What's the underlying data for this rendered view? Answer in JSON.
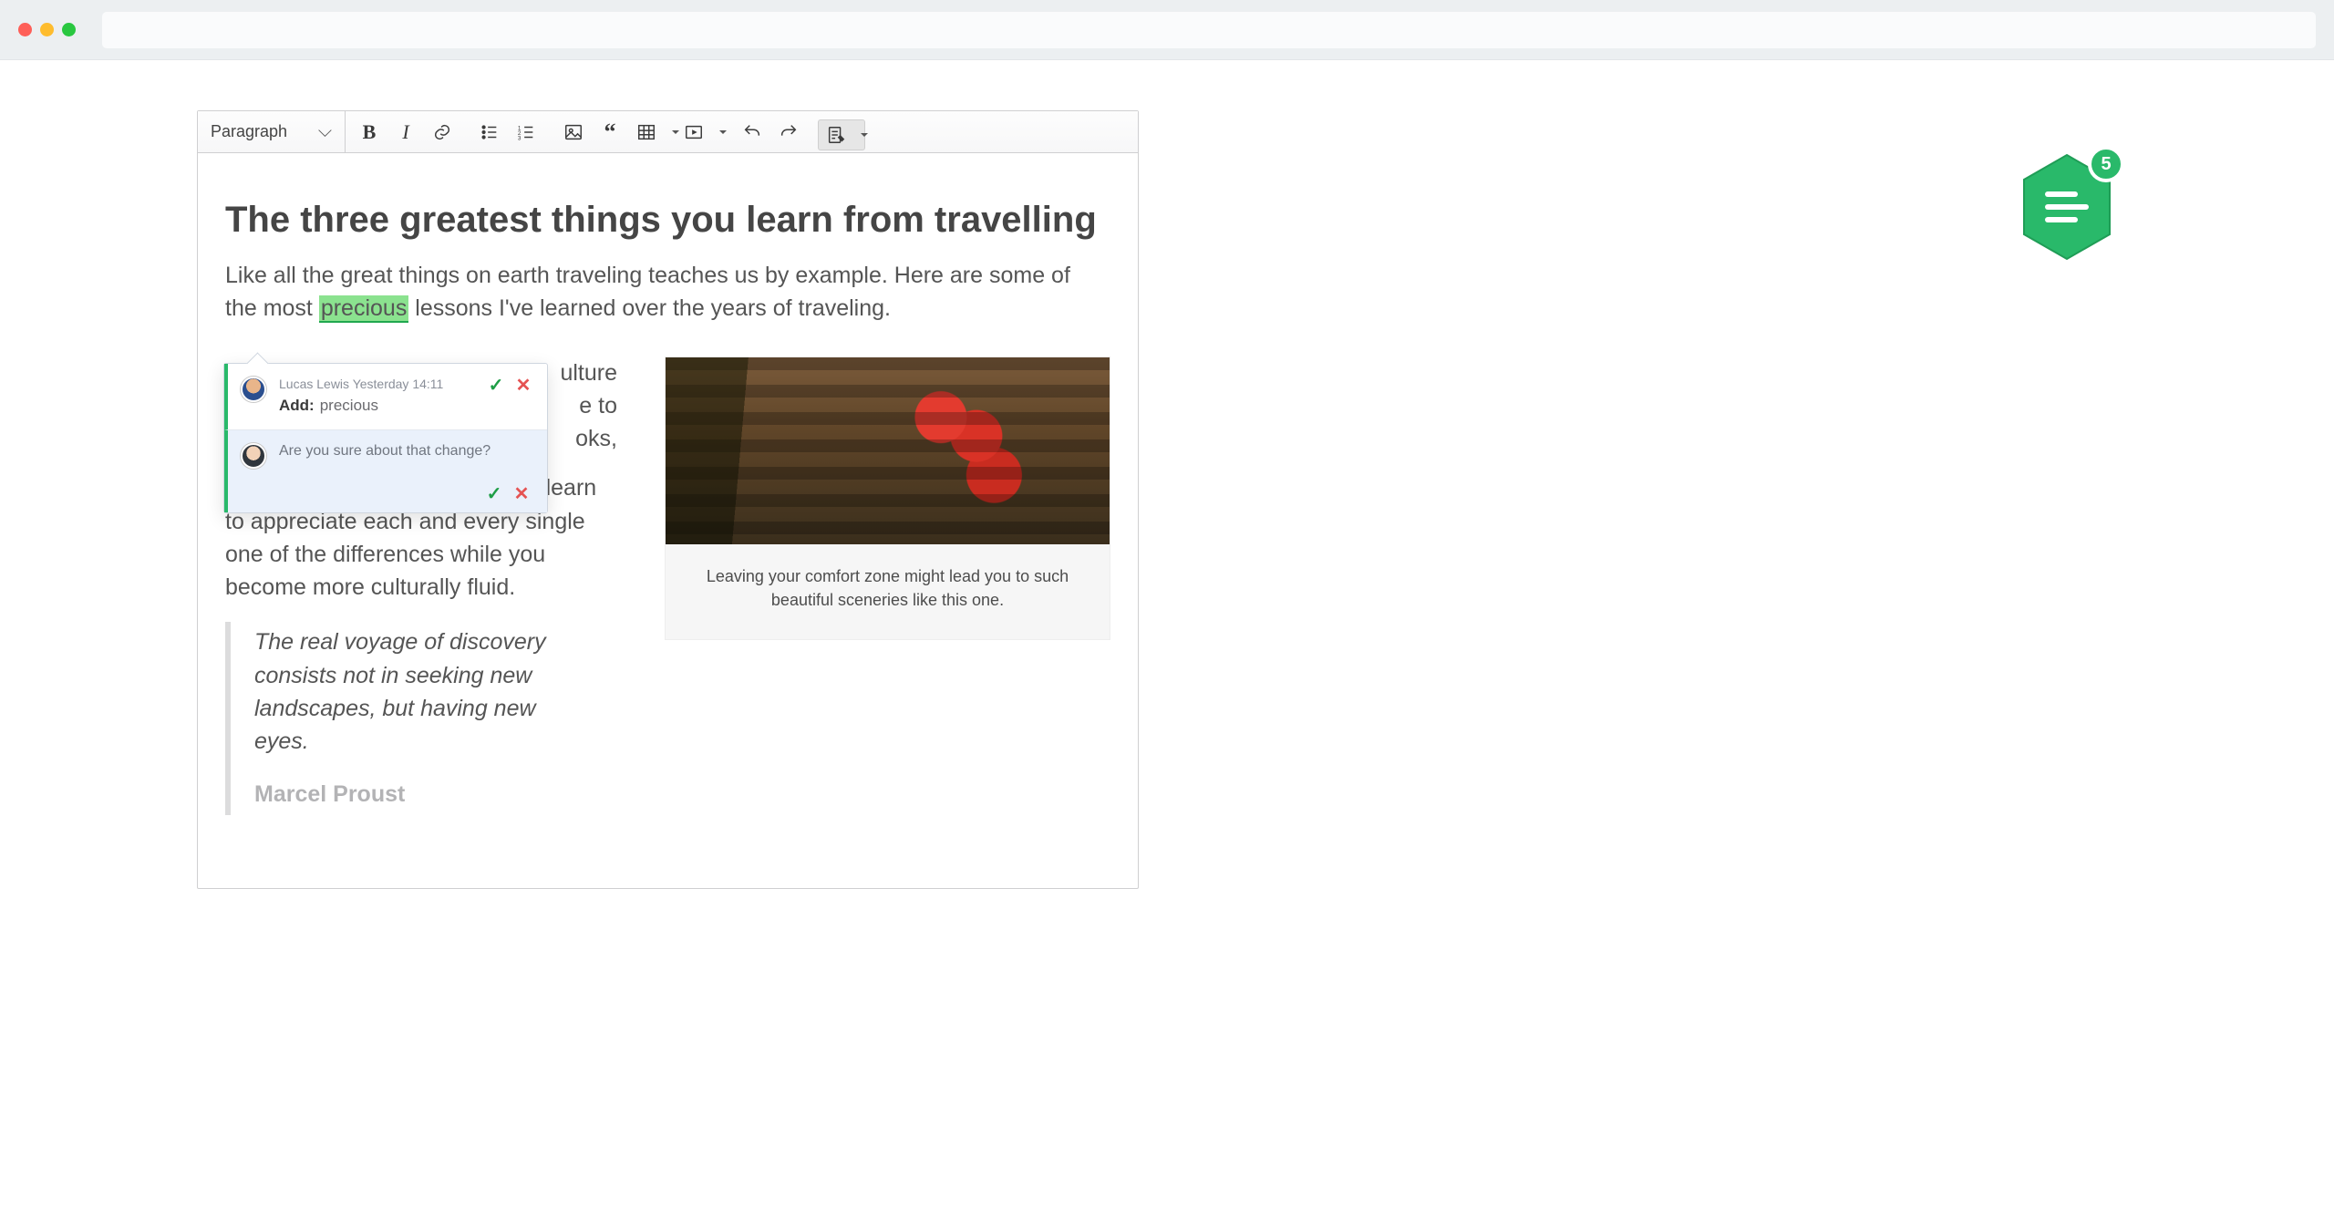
{
  "badge": {
    "count": "5"
  },
  "toolbar": {
    "style_select": "Paragraph"
  },
  "doc": {
    "title": "The three greatest things you learn from travelling",
    "lead_pre": "Like all the great things on earth traveling teaches us by example. Here are some of the most ",
    "lead_highlight": "precious",
    "lead_post": " lessons I've learned over the years of traveling.",
    "body_hidden_1": "ulture",
    "body_hidden_2": "e to",
    "body_hidden_3": "oks,",
    "body_para": "cultural diversity in person. You learn to appreciate each and every single one of the differences while you become more culturally fluid.",
    "quote_text": "The real voyage of discovery consists not in seeking new landscapes, but having new eyes.",
    "quote_author": "Marcel Proust",
    "caption": "Leaving your comfort zone might lead you to such beautiful sceneries like this one."
  },
  "suggestion": {
    "author": "Lucas Lewis",
    "timestamp": "Yesterday 14:11",
    "verb": "Add:",
    "term": "precious",
    "reply_text": "Are you sure about that change?"
  }
}
